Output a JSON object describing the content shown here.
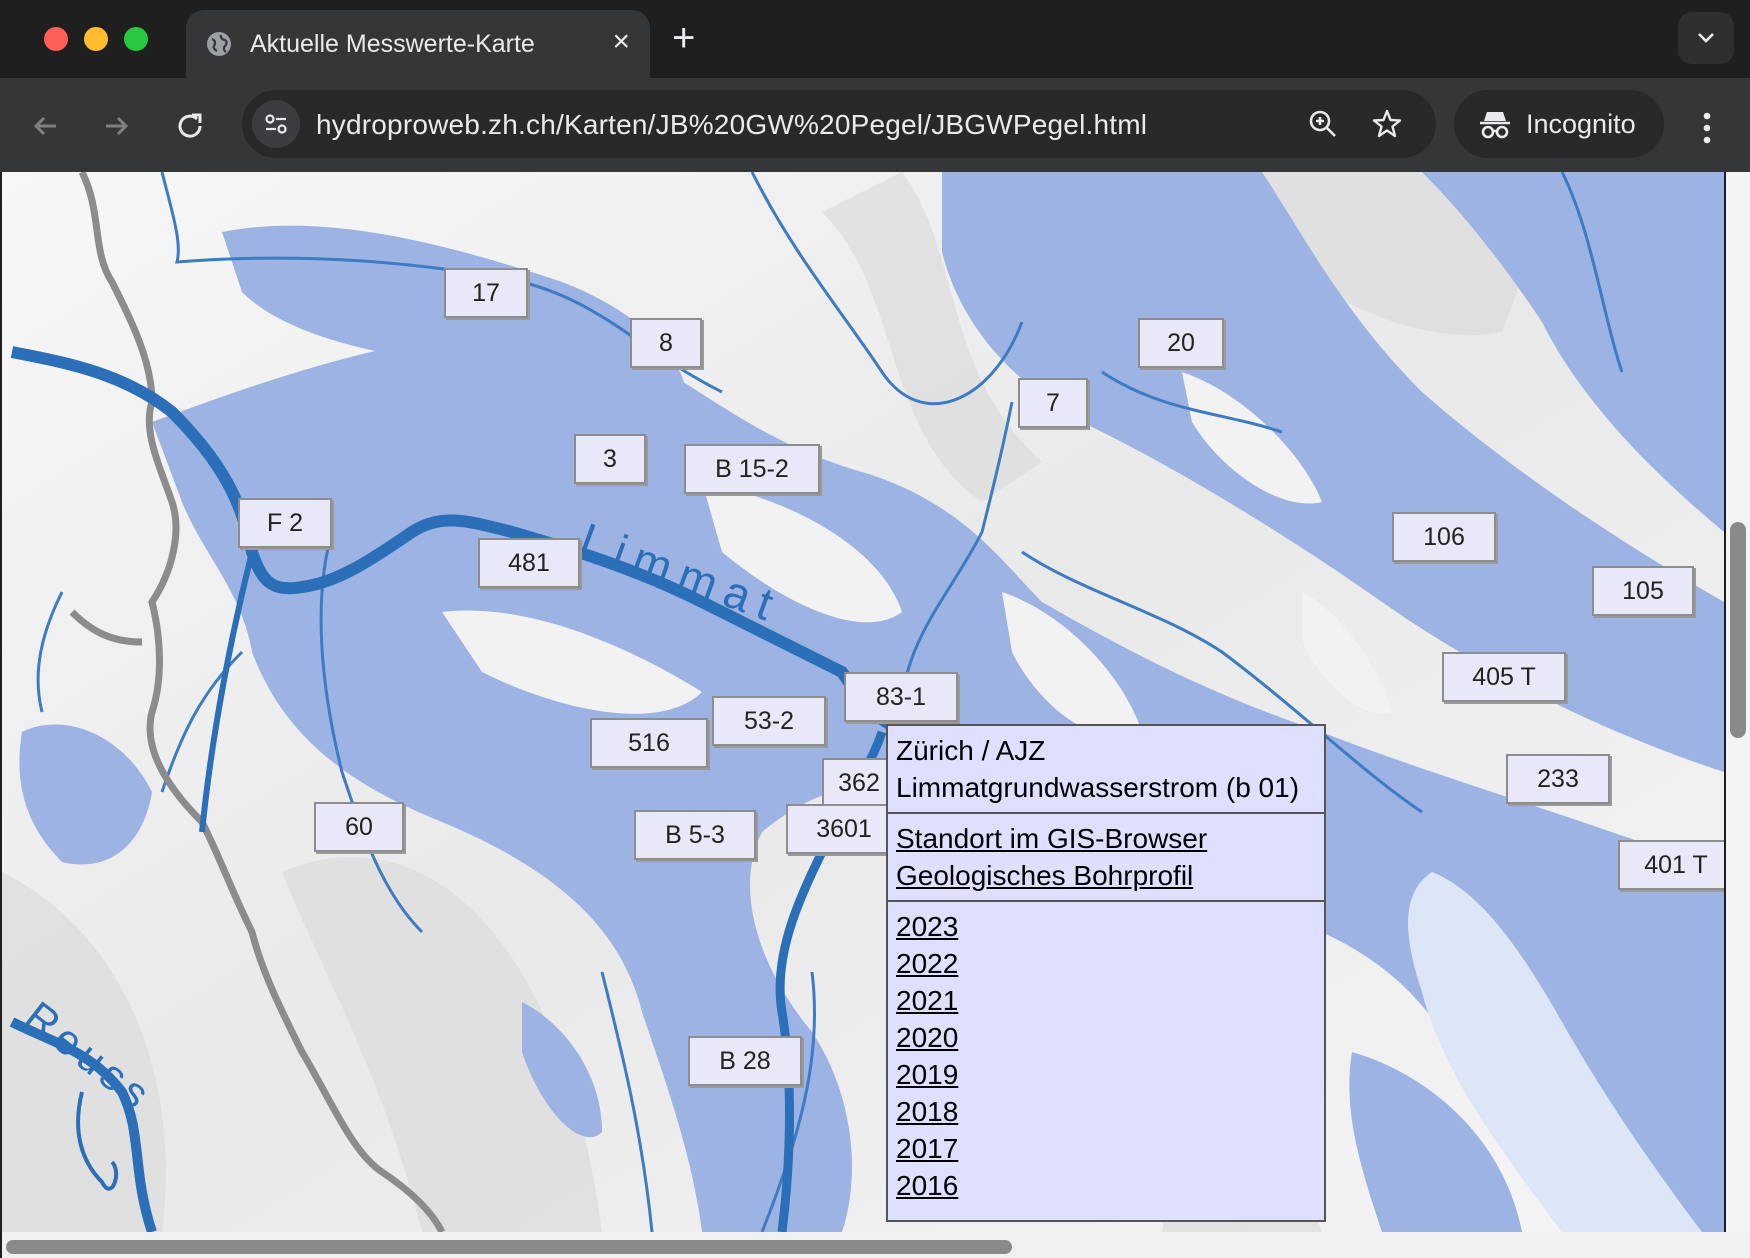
{
  "browser": {
    "tab_title": "Aktuelle Messwerte-Karte",
    "url": "hydroproweb.zh.ch/Karten/JB%20GW%20Pegel/JBGWPegel.html",
    "incognito_label": "Incognito",
    "colors": {
      "close": "#ff5f57",
      "minimize": "#febc2e",
      "maximize": "#28c840"
    }
  },
  "map": {
    "river_labels": [
      "Limmat",
      "Reuss"
    ],
    "markers": [
      "17",
      "8",
      "20",
      "7",
      "3",
      "B 15-2",
      "F 2",
      "481",
      "106",
      "105",
      "405 T",
      "83-1",
      "53-2",
      "516",
      "362",
      "233",
      "60",
      "B 5-3",
      "3601",
      "401 T",
      "B 28"
    ],
    "colors": {
      "aquifer": "#9db3e3",
      "river": "#2b6fb8",
      "lake": "#dce6f7",
      "border": "#8c8c8c",
      "terrain": "#f4f4f4"
    }
  },
  "popup": {
    "location": "Zürich / AJZ",
    "description": "Limmatgrundwasserstrom (b 01)",
    "links": [
      "Standort im GIS-Browser",
      "Geologisches Bohrprofil"
    ],
    "years": [
      "2023",
      "2022",
      "2021",
      "2020",
      "2019",
      "2018",
      "2017",
      "2016"
    ]
  }
}
